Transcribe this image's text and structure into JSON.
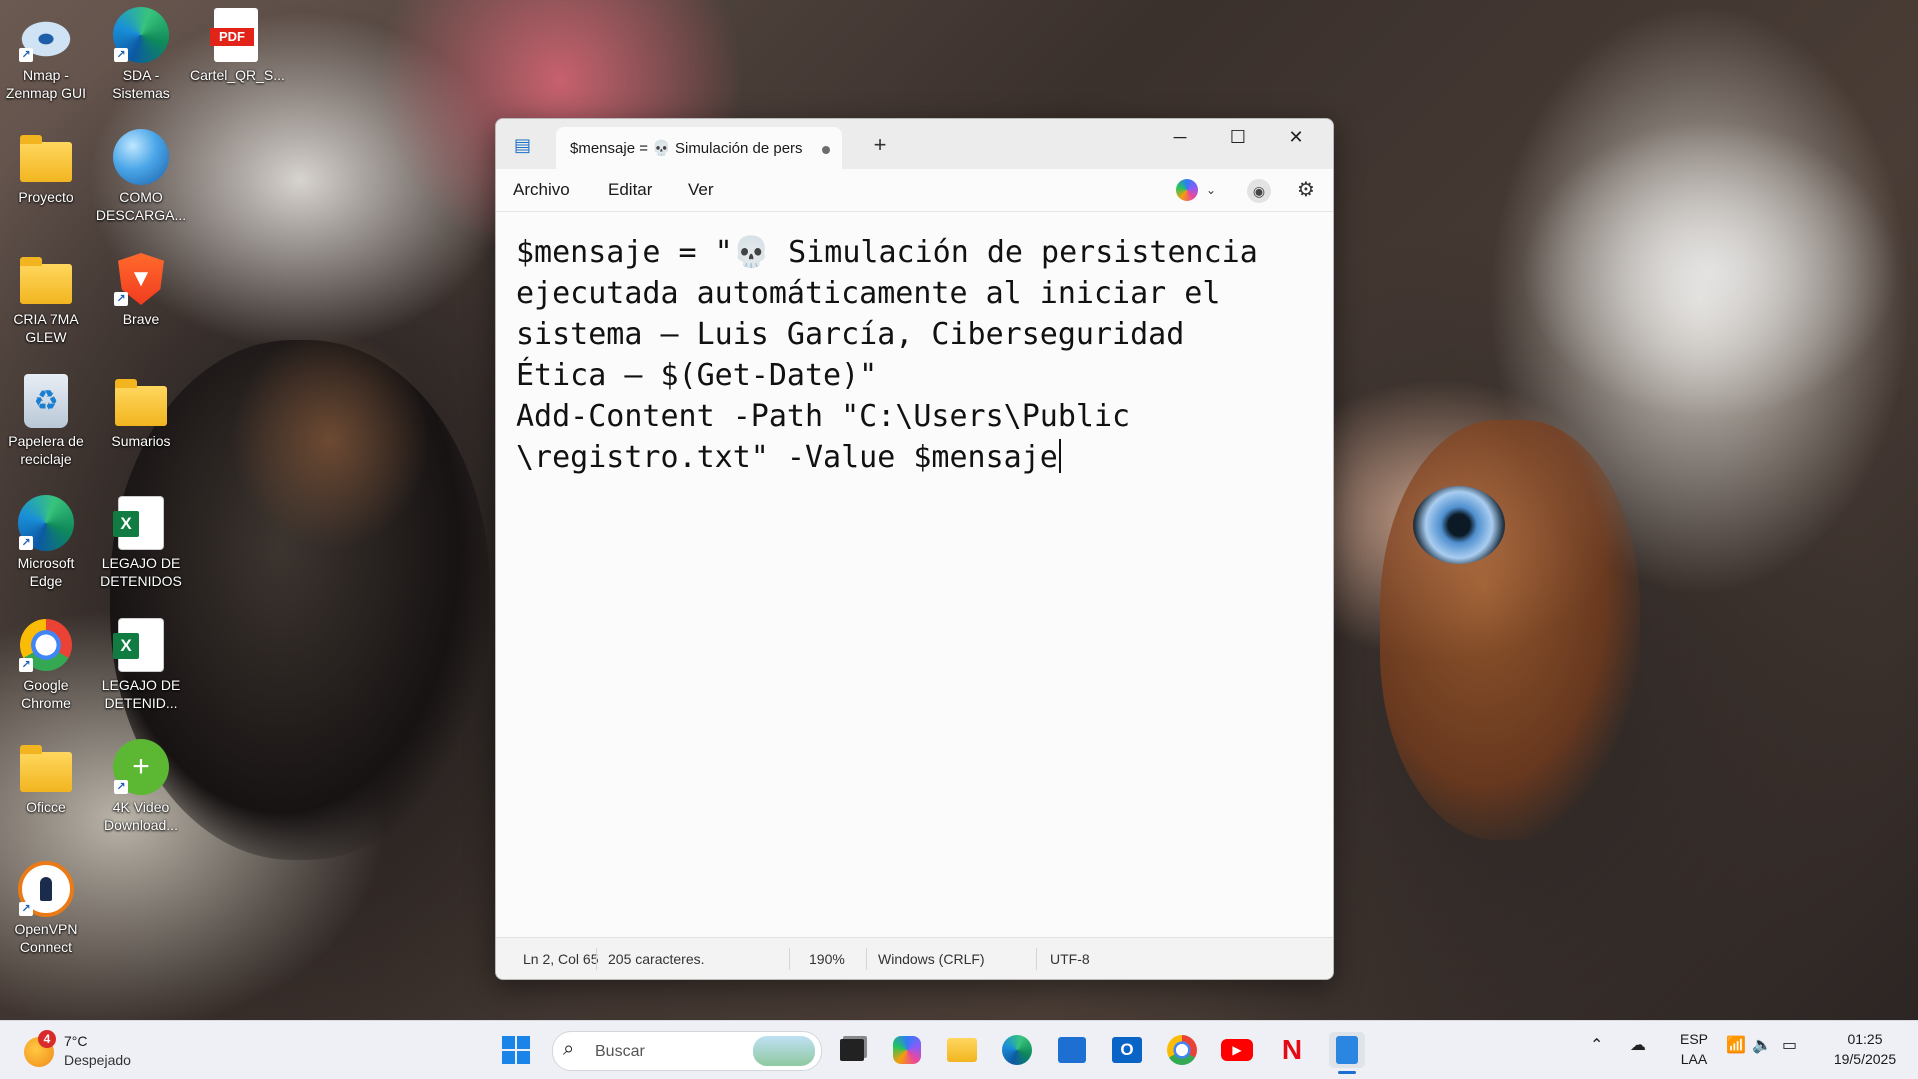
{
  "desktop": {
    "icons": [
      {
        "label": "Nmap - Zenmap GUI",
        "icon": "nmap-icon"
      },
      {
        "label": "SDA - Sistemas",
        "icon": "edge-icon"
      },
      {
        "label": "Cartel_QR_S...",
        "icon": "pdf-icon",
        "badge": "PDF"
      },
      {
        "label": "Proyecto",
        "icon": "folder-icon"
      },
      {
        "label": "COMO DESCARGA...",
        "icon": "globe-icon"
      },
      {
        "label": "CRIA 7MA GLEW",
        "icon": "folder-icon"
      },
      {
        "label": "Brave",
        "icon": "brave-icon"
      },
      {
        "label": "Papelera de reciclaje",
        "icon": "recycle-bin-icon"
      },
      {
        "label": "Sumarios",
        "icon": "folder-icon"
      },
      {
        "label": "Microsoft Edge",
        "icon": "edge-icon"
      },
      {
        "label": "LEGAJO DE DETENIDOS",
        "icon": "excel-icon"
      },
      {
        "label": "Google Chrome",
        "icon": "chrome-icon"
      },
      {
        "label": "LEGAJO DE DETENID...",
        "icon": "excel-icon"
      },
      {
        "label": "Oficce",
        "icon": "folder-icon"
      },
      {
        "label": "4K Video Download...",
        "icon": "cloud-download-icon"
      },
      {
        "label": "OpenVPN Connect",
        "icon": "openvpn-icon"
      }
    ]
  },
  "notepad": {
    "tab_title": "$mensaje = 💀 Simulación de pers",
    "new_tab_label": "+",
    "menu": [
      "Archivo",
      "Editar",
      "Ver"
    ],
    "content_lines": [
      "$mensaje = \"💀 Simulación de persistencia",
      "ejecutada automáticamente al iniciar el",
      "sistema — Luis García, Ciberseguridad",
      "Ética — $(Get-Date)\"",
      "Add-Content -Path \"C:\\Users\\Public",
      "\\registro.txt\" -Value $mensaje"
    ],
    "status": {
      "position": "Ln 2, Col 65",
      "characters": "205 caracteres.",
      "zoom": "190%",
      "line_ending": "Windows (CRLF)",
      "encoding": "UTF-8"
    },
    "window_controls": {
      "minimize": "─",
      "maximize": "☐",
      "close": "✕"
    }
  },
  "taskbar": {
    "weather": {
      "badge": "4",
      "temp": "7°C",
      "desc": "Despejado"
    },
    "search_placeholder": "Buscar",
    "language": {
      "line1": "ESP",
      "line2": "LAA"
    },
    "clock": {
      "time": "01:25",
      "date": "19/5/2025"
    }
  },
  "colors": {
    "accent": "#1a6fd0",
    "squiggle": "#e0262b",
    "titlebar": "#ececec"
  }
}
